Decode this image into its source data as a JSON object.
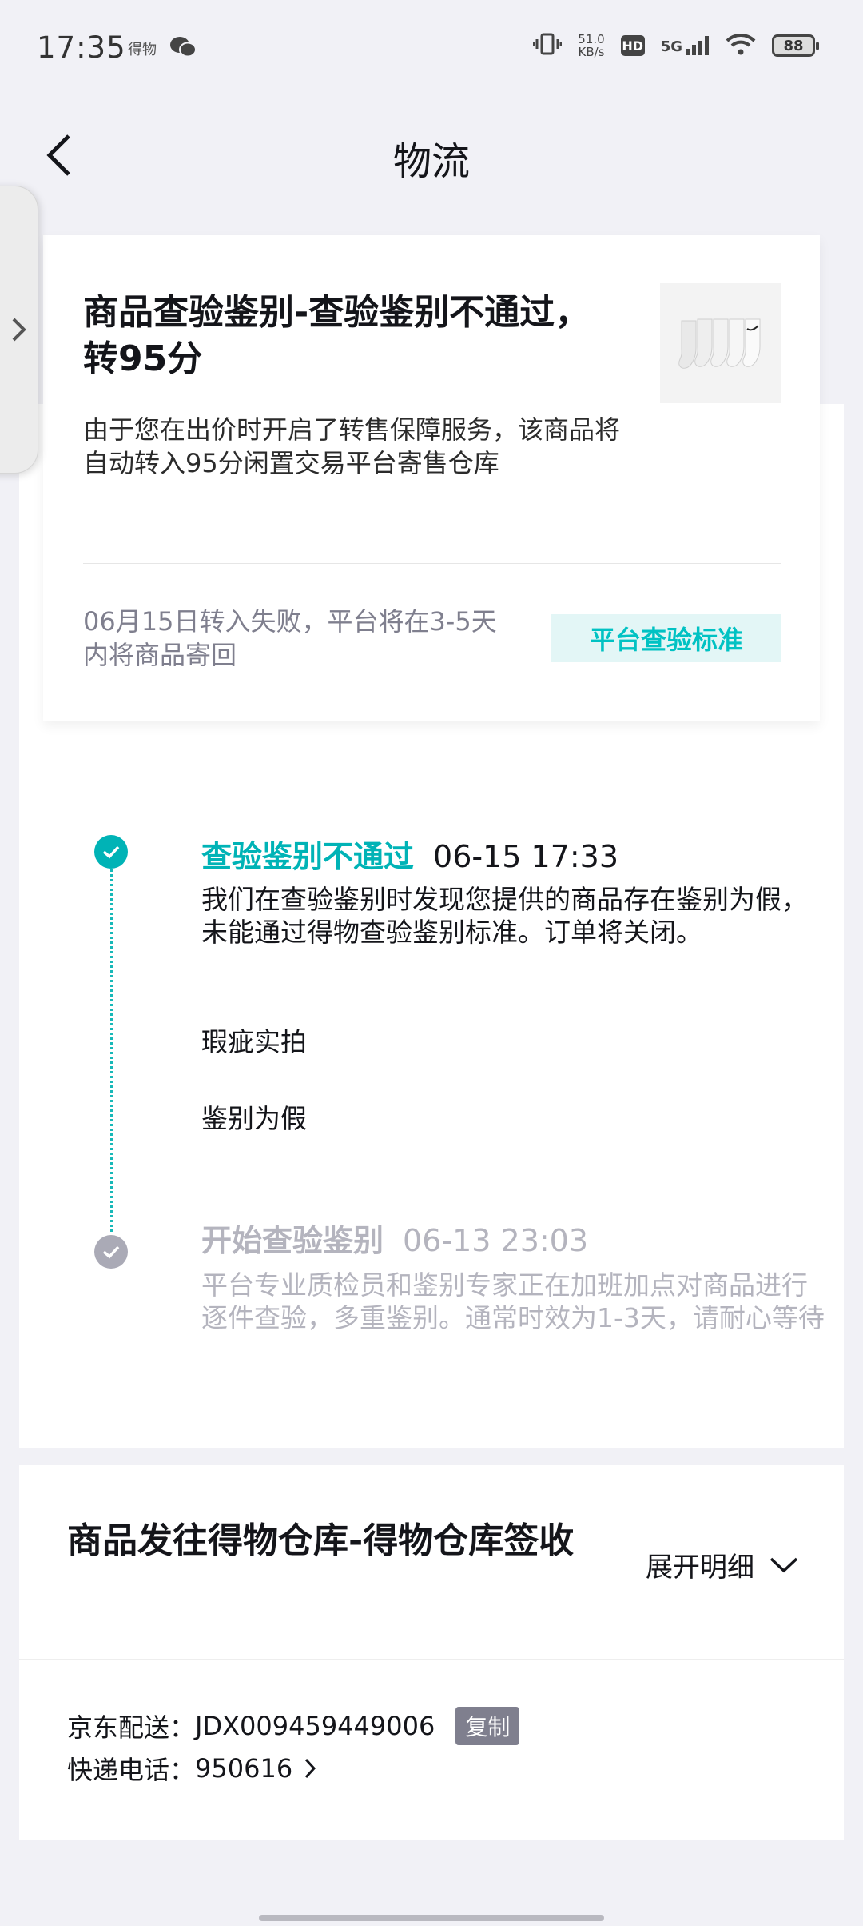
{
  "status_bar": {
    "time": "17:35",
    "notify_text": "得物",
    "speed_value": "51.0",
    "speed_unit": "KB/s",
    "hd_label": "HD",
    "network": "5G",
    "battery": "88"
  },
  "nav": {
    "title": "物流"
  },
  "summary": {
    "title": "商品查验鉴别-查验鉴别不通过，转95分",
    "description": "由于您在出价时开启了转售保障服务，该商品将自动转入95分闲置交易平台寄售仓库",
    "note": "06月15日转入失败，平台将在3-5天内将商品寄回",
    "standard_button": "平台查验标准"
  },
  "timeline": {
    "items": [
      {
        "status": "查验鉴别不通过",
        "time": "06-15 17:33",
        "description": "我们在查验鉴别时发现您提供的商品存在鉴别为假，未能通过得物查验鉴别标准。订单将关闭。",
        "flaw_label": "瑕疵实拍",
        "flaw_value": "鉴别为假"
      },
      {
        "status": "开始查验鉴别",
        "time": "06-13 23:03",
        "description": "平台专业质检员和鉴别专家正在加班加点对商品进行逐件查验，多重鉴别。通常时效为1-3天，请耐心等待"
      }
    ]
  },
  "shipping": {
    "title": "商品发往得物仓库-得物仓库签收",
    "expand_label": "展开明细",
    "carrier_label": "京东配送：",
    "tracking_number": "JDX009459449006",
    "copy_label": "复制",
    "phone_label": "快递电话：",
    "phone_number": "950616"
  },
  "colors": {
    "accent": "#00b3b6",
    "muted": "#b4b4be",
    "tag_bg": "#e3f6f6"
  }
}
